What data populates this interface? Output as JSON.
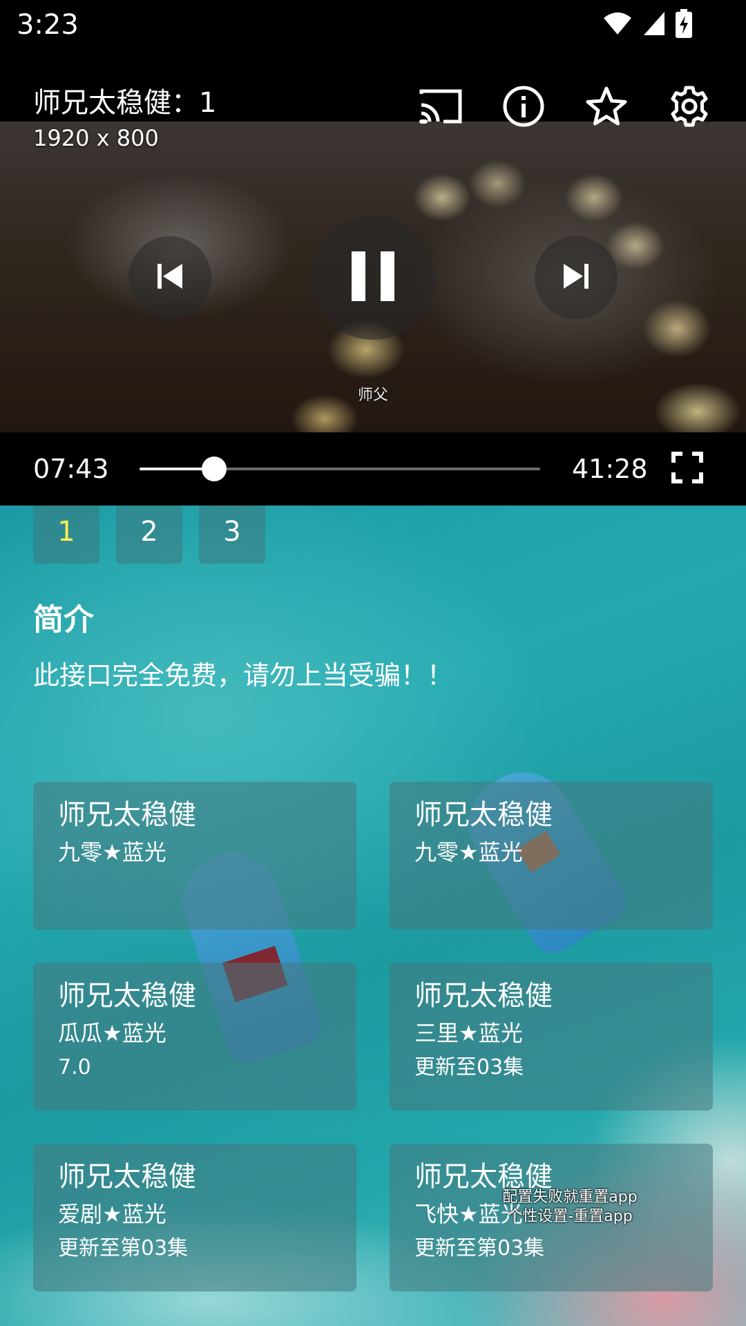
{
  "status_bar": {
    "time": "3:23"
  },
  "player": {
    "title": "师兄太稳健：1",
    "resolution": "1920 x 800",
    "subtitle": "师父",
    "current_time": "07:43",
    "total_time": "41:28",
    "progress": 0.187,
    "icons": {
      "cast": "cast-icon",
      "info": "info-icon",
      "favorite": "star-icon",
      "settings": "gear-icon",
      "previous": "skip-previous-icon",
      "pause": "pause-icon",
      "next": "skip-next-icon",
      "fullscreen": "fullscreen-icon"
    }
  },
  "episodes": {
    "tabs": [
      "1",
      "2",
      "3"
    ],
    "active_index": 0,
    "active_color": "#ffee55"
  },
  "intro": {
    "heading": "简介",
    "text": "此接口完全免费，请勿上当受骗！！"
  },
  "sources": [
    {
      "title": "师兄太稳健",
      "line": "九零★蓝光",
      "meta": ""
    },
    {
      "title": "师兄太稳健",
      "line": "九零★蓝光",
      "meta": ""
    },
    {
      "title": "师兄太稳健",
      "line": "瓜瓜★蓝光",
      "meta": "7.0"
    },
    {
      "title": "师兄太稳健",
      "line": "三里★蓝光",
      "meta": "更新至03集"
    },
    {
      "title": "师兄太稳健",
      "line": "爱剧★蓝光",
      "meta": "更新至第03集"
    },
    {
      "title": "师兄太稳健",
      "line": "飞快★蓝光",
      "meta": "更新至第03集"
    }
  ],
  "toast": {
    "line1": "配置失败就重置app",
    "line2": "个性设置-重置app"
  }
}
